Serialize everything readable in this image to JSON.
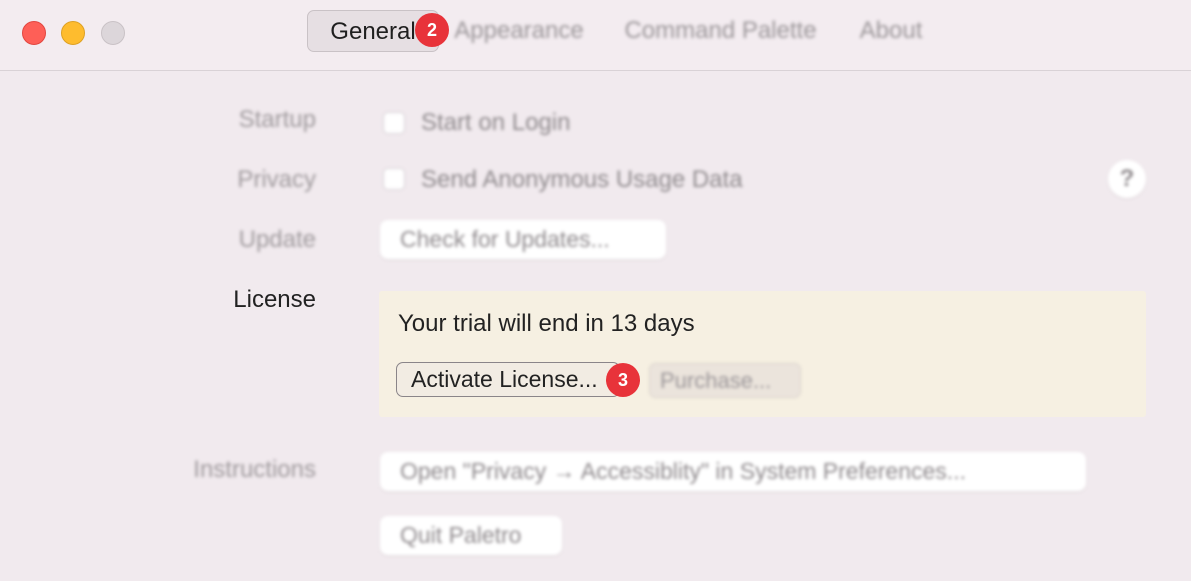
{
  "window": {
    "tabs": [
      {
        "label": "General"
      },
      {
        "label": "Appearance"
      },
      {
        "label": "Command Palette"
      },
      {
        "label": "About"
      }
    ],
    "badges": [
      "2",
      "3"
    ]
  },
  "settings": {
    "startup": {
      "label": "Startup",
      "option": "Start on Login",
      "checked": false
    },
    "privacy": {
      "label": "Privacy",
      "option": "Send Anonymous Usage Data",
      "checked": false,
      "help": "?"
    },
    "update": {
      "label": "Update",
      "button": "Check for Updates..."
    },
    "license": {
      "label": "License",
      "message": "Your trial will end in 13 days",
      "activate_button": "Activate License...",
      "purchase_button": "Purchase..."
    },
    "instructions": {
      "label": "Instructions",
      "open_button": "Open \"Privacy → Accessiblity\" in System Preferences...",
      "quit_button": "Quit Paletro"
    }
  },
  "colors": {
    "window_bg": "#f1eaee",
    "license_bg": "#f6f0e2",
    "badge": "#e8333a",
    "close": "#fe5f57",
    "minimize": "#febc2e"
  }
}
